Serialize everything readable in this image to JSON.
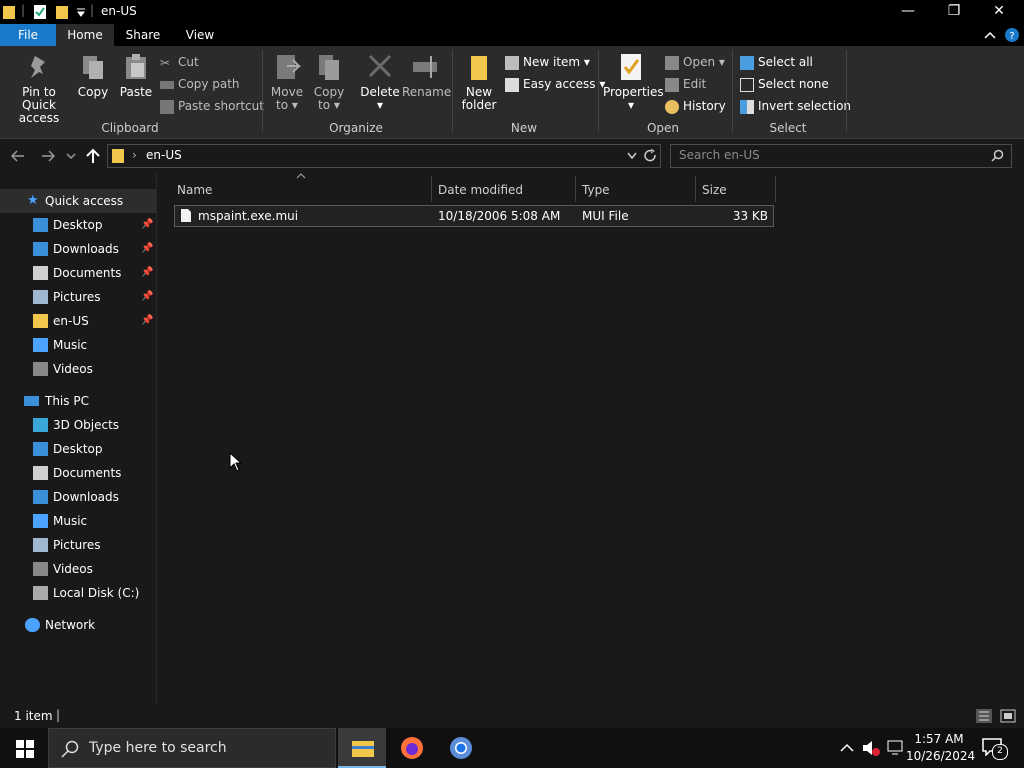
{
  "window": {
    "title": "en-US",
    "minimize": "—",
    "restore": "❐",
    "close": "✕"
  },
  "tabs": {
    "file": "File",
    "home": "Home",
    "share": "Share",
    "view": "View"
  },
  "ribbon": {
    "clipboard": {
      "label": "Clipboard",
      "pin_line1": "Pin to Quick",
      "pin_line2": "access",
      "copy": "Copy",
      "paste": "Paste",
      "cut": "Cut",
      "copy_path": "Copy path",
      "paste_shortcut": "Paste shortcut"
    },
    "organize": {
      "label": "Organize",
      "move_line1": "Move",
      "move_line2": "to",
      "copy_line1": "Copy",
      "copy_line2": "to",
      "delete": "Delete",
      "rename": "Rename"
    },
    "new": {
      "label": "New",
      "new_folder_line1": "New",
      "new_folder_line2": "folder",
      "new_item": "New item",
      "easy_access": "Easy access"
    },
    "open": {
      "label": "Open",
      "properties": "Properties",
      "open": "Open",
      "edit": "Edit",
      "history": "History"
    },
    "select": {
      "label": "Select",
      "select_all": "Select all",
      "select_none": "Select none",
      "invert": "Invert selection"
    }
  },
  "address": {
    "path": "en-US",
    "search_placeholder": "Search en-US"
  },
  "nav": {
    "quick_access": "Quick access",
    "quick_items": [
      {
        "label": "Desktop"
      },
      {
        "label": "Downloads"
      },
      {
        "label": "Documents"
      },
      {
        "label": "Pictures"
      },
      {
        "label": "en-US"
      },
      {
        "label": "Music"
      },
      {
        "label": "Videos"
      }
    ],
    "this_pc": "This PC",
    "pc_items": [
      {
        "label": "3D Objects"
      },
      {
        "label": "Desktop"
      },
      {
        "label": "Documents"
      },
      {
        "label": "Downloads"
      },
      {
        "label": "Music"
      },
      {
        "label": "Pictures"
      },
      {
        "label": "Videos"
      },
      {
        "label": "Local Disk (C:)"
      }
    ],
    "network": "Network"
  },
  "table": {
    "headers": {
      "name": "Name",
      "date": "Date modified",
      "type": "Type",
      "size": "Size"
    },
    "rows": [
      {
        "name": "mspaint.exe.mui",
        "date": "10/18/2006 5:08 AM",
        "type": "MUI File",
        "size": "33 KB"
      }
    ]
  },
  "status": {
    "count": "1 item"
  },
  "taskbar": {
    "search_text": "Type here to search",
    "time": "1:57 AM",
    "date": "10/26/2024",
    "notification_count": "2"
  },
  "colors": {
    "accent": "#1979ca",
    "folder": "#f0c74a"
  }
}
